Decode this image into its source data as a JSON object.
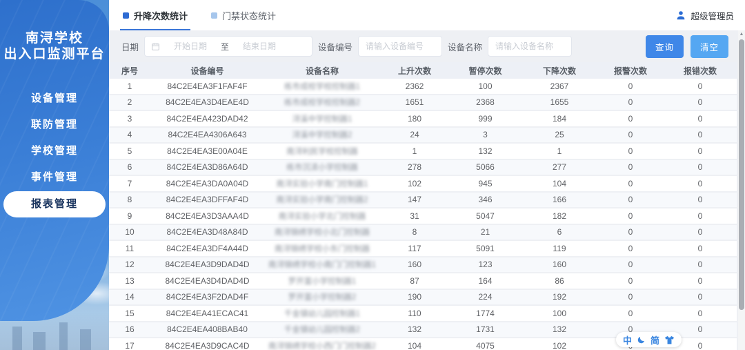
{
  "sidebar": {
    "title_line1": "南浔学校",
    "title_line2": "出入口监测平台",
    "items": [
      {
        "label": "设备管理",
        "active": false
      },
      {
        "label": "联防管理",
        "active": false
      },
      {
        "label": "学校管理",
        "active": false
      },
      {
        "label": "事件管理",
        "active": false
      },
      {
        "label": "报表管理",
        "active": true
      }
    ]
  },
  "topbar": {
    "tabs": [
      {
        "label": "升降次数统计",
        "active": true
      },
      {
        "label": "门禁状态统计",
        "active": false
      }
    ],
    "user_name": "超级管理员"
  },
  "filters": {
    "date_label": "日期",
    "start_date_placeholder": "开始日期",
    "range_separator": "至",
    "end_date_placeholder": "结束日期",
    "device_id_label": "设备编号",
    "device_id_placeholder": "请输入设备编号",
    "device_name_label": "设备名称",
    "device_name_placeholder": "请输入设备名称",
    "search_button": "查询",
    "clear_button": "清空"
  },
  "table": {
    "columns": [
      "序号",
      "设备编号",
      "设备名称",
      "上升次数",
      "暂停次数",
      "下降次数",
      "报警次数",
      "报错次数"
    ],
    "device_names_blurred": true,
    "rows": [
      {
        "no": 1,
        "device_id": "84C2E4EA3F1FAF4F",
        "device_name": "练市成校学校控制器1",
        "up": 2362,
        "pause": 100,
        "down": 2367,
        "alarm": 0,
        "error": 0
      },
      {
        "no": 2,
        "device_id": "84C2E4EA3D4EAE4D",
        "device_name": "练市成校学校控制器2",
        "up": 1651,
        "pause": 2368,
        "down": 1655,
        "alarm": 0,
        "error": 0
      },
      {
        "no": 3,
        "device_id": "84C2E4EA423DAD42",
        "device_name": "浔溪中学控制器1",
        "up": 180,
        "pause": 999,
        "down": 184,
        "alarm": 0,
        "error": 0
      },
      {
        "no": 4,
        "device_id": "84C2E4EA4306A643",
        "device_name": "浔溪中学控制器2",
        "up": 24,
        "pause": 3,
        "down": 25,
        "alarm": 0,
        "error": 0
      },
      {
        "no": 5,
        "device_id": "84C2E4EA3E00A04E",
        "device_name": "南浔利民学校控制器",
        "up": 1,
        "pause": 132,
        "down": 1,
        "alarm": 0,
        "error": 0
      },
      {
        "no": 6,
        "device_id": "84C2E4EA3D86A64D",
        "device_name": "练市沉渎小学控制器",
        "up": 278,
        "pause": 5066,
        "down": 277,
        "alarm": 0,
        "error": 0
      },
      {
        "no": 7,
        "device_id": "84C2E4EA3DA0A04D",
        "device_name": "南浔实验小学南门控制器1",
        "up": 102,
        "pause": 945,
        "down": 104,
        "alarm": 0,
        "error": 0
      },
      {
        "no": 8,
        "device_id": "84C2E4EA3DFFAF4D",
        "device_name": "南浔实验小学南门控制器2",
        "up": 147,
        "pause": 346,
        "down": 166,
        "alarm": 0,
        "error": 0
      },
      {
        "no": 9,
        "device_id": "84C2E4EA3D3AAA4D",
        "device_name": "南浔实验小学北门控制器",
        "up": 31,
        "pause": 5047,
        "down": 182,
        "alarm": 0,
        "error": 0
      },
      {
        "no": 10,
        "device_id": "84C2E4EA3D48A84D",
        "device_name": "南浔锦绣学校小北门控制器",
        "up": 8,
        "pause": 21,
        "down": 6,
        "alarm": 0,
        "error": 0
      },
      {
        "no": 11,
        "device_id": "84C2E4EA3DF4A44D",
        "device_name": "南浔锦绣学校小东门控制器",
        "up": 117,
        "pause": 5091,
        "down": 119,
        "alarm": 0,
        "error": 0
      },
      {
        "no": 12,
        "device_id": "84C2E4EA3D9DAD4D",
        "device_name": "南浔锦绣学校小南门门控制器1",
        "up": 160,
        "pause": 123,
        "down": 160,
        "alarm": 0,
        "error": 0
      },
      {
        "no": 13,
        "device_id": "84C2E4EA3D4DAD4D",
        "device_name": "罗开富小学控制器1",
        "up": 87,
        "pause": 164,
        "down": 86,
        "alarm": 0,
        "error": 0
      },
      {
        "no": 14,
        "device_id": "84C2E4EA3F2DAD4F",
        "device_name": "罗开富小学控制器2",
        "up": 190,
        "pause": 224,
        "down": 192,
        "alarm": 0,
        "error": 0
      },
      {
        "no": 15,
        "device_id": "84C2E4EA41ECAC41",
        "device_name": "千金镇幼儿园控制器1",
        "up": 110,
        "pause": 1774,
        "down": 100,
        "alarm": 0,
        "error": 0
      },
      {
        "no": 16,
        "device_id": "84C2E4EA408BAB40",
        "device_name": "千金镇幼儿园控制器2",
        "up": 132,
        "pause": 1731,
        "down": 132,
        "alarm": 0,
        "error": 0
      },
      {
        "no": 17,
        "device_id": "84C2E4EA3D9CAC4D",
        "device_name": "南浔锦绣学校小西门门控制器2",
        "up": 104,
        "pause": 4075,
        "down": 102,
        "alarm": 0,
        "error": 0
      }
    ]
  },
  "ime_bar": {
    "chinese_mode": "中",
    "simplified": "简"
  },
  "colors": {
    "sidebar_blue": "#3579d6",
    "accent_blue": "#2e6bd3",
    "tab_underline": "#3a76d8",
    "search_button_bg": "#3f87e8",
    "clear_button_bg": "#55a7f2",
    "table_header_bg": "#edf0f6",
    "ime_icon_blue": "#3a86e0"
  }
}
